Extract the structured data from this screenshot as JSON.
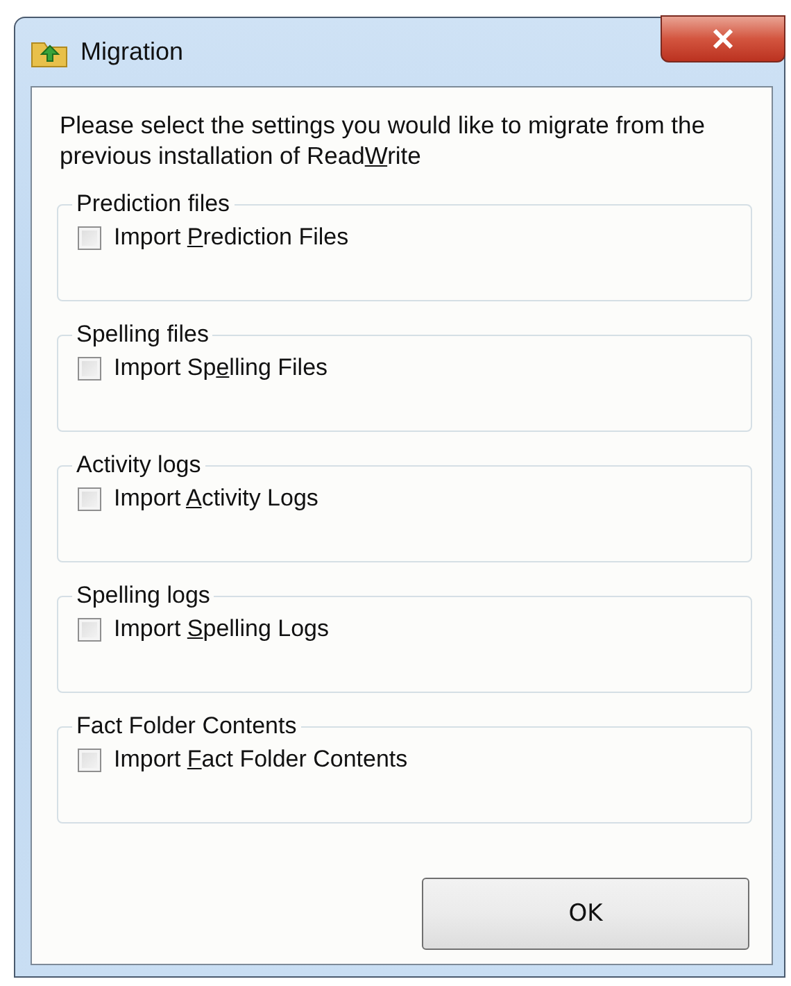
{
  "window": {
    "title": "Migration"
  },
  "description": {
    "before": "Please select the settings you would like to migrate from the previous installation of Read",
    "key": "W",
    "after": "rite"
  },
  "groups": [
    {
      "title": "Prediction files",
      "option": {
        "before": "Import ",
        "key": "P",
        "after": "rediction Files"
      },
      "checked": false
    },
    {
      "title": "Spelling files",
      "option": {
        "before": "Import Sp",
        "key": "e",
        "after": "lling Files"
      },
      "checked": false
    },
    {
      "title": "Activity logs",
      "option": {
        "before": "Import ",
        "key": "A",
        "after": "ctivity Logs"
      },
      "checked": false
    },
    {
      "title": "Spelling logs",
      "option": {
        "before": "Import ",
        "key": "S",
        "after": "pelling Logs"
      },
      "checked": false
    },
    {
      "title": "Fact Folder Contents",
      "option": {
        "before": "Import ",
        "key": "F",
        "after": "act Folder Contents"
      },
      "checked": false
    }
  ],
  "buttons": [
    {
      "label": "OK"
    }
  ]
}
